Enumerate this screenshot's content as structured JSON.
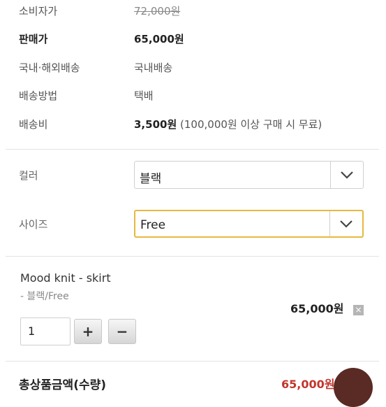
{
  "info": {
    "consumer_price_label": "소비자가",
    "consumer_price": "72,000원",
    "sale_price_label": "판매가",
    "sale_price": "65,000원",
    "shipping_scope_label": "국내·해외배송",
    "shipping_scope": "국내배송",
    "shipping_method_label": "배송방법",
    "shipping_method": "택배",
    "shipping_fee_label": "배송비",
    "shipping_fee": "3,500원",
    "shipping_fee_note": "(100,000원 이상 구매 시 무료)"
  },
  "options": {
    "color_label": "컬러",
    "color_value": "블랙",
    "size_label": "사이즈",
    "size_value": "Free"
  },
  "selected": {
    "name": "Mood knit - skirt",
    "option": "- 블랙/Free",
    "price": "65,000원",
    "quantity": "1",
    "plus": "+",
    "minus": "−",
    "delete": "×"
  },
  "total": {
    "label": "총상품금액(수량)",
    "value": "65,000원 (1개)"
  },
  "colors": {
    "focus_border": "#e6b93e",
    "total_price": "#c0362c"
  }
}
